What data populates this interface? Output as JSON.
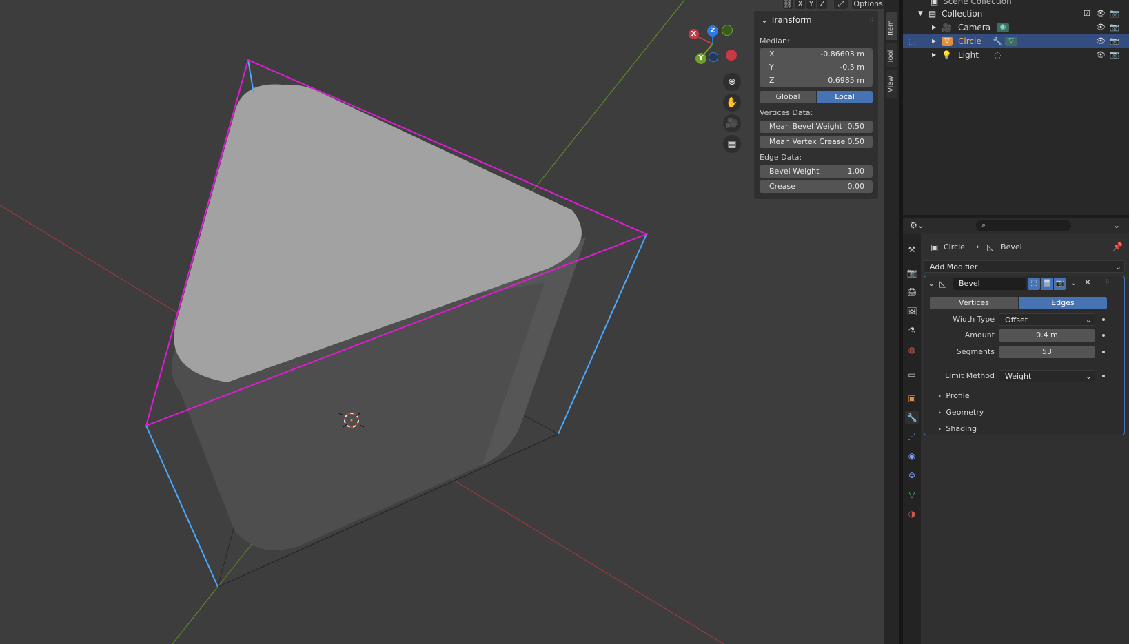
{
  "viewport": {
    "header_buttons": [
      "X",
      "Y",
      "Z"
    ],
    "options_label": "Options",
    "gizmo": {
      "x": "X",
      "y": "Y",
      "z": "Z"
    }
  },
  "npanel": {
    "title": "Transform",
    "median_label": "Median:",
    "x": {
      "label": "X",
      "value": "-0.86603 m"
    },
    "y": {
      "label": "Y",
      "value": "-0.5 m"
    },
    "z": {
      "label": "Z",
      "value": "0.6985 m"
    },
    "space": {
      "global": "Global",
      "local": "Local",
      "active": "Local"
    },
    "vertices_label": "Vertices Data:",
    "mean_bevel_weight": {
      "label": "Mean Bevel Weight",
      "value": "0.50"
    },
    "mean_vertex_crease": {
      "label": "Mean Vertex Crease",
      "value": "0.50"
    },
    "edge_label": "Edge Data:",
    "bevel_weight": {
      "label": "Bevel Weight",
      "value": "1.00"
    },
    "crease": {
      "label": "Crease",
      "value": "0.00"
    }
  },
  "side_tabs": [
    "Item",
    "Tool",
    "View"
  ],
  "outliner": {
    "scene_collection": "Scene Collection",
    "collection": "Collection",
    "items": [
      "Camera",
      "Circle",
      "Light"
    ]
  },
  "properties": {
    "breadcrumb_object": "Circle",
    "breadcrumb_modifier": "Bevel",
    "add_modifier": "Add Modifier",
    "modifier_name": "Bevel",
    "affect": {
      "vertices": "Vertices",
      "edges": "Edges",
      "active": "Edges"
    },
    "width_type": {
      "label": "Width Type",
      "value": "Offset"
    },
    "amount": {
      "label": "Amount",
      "value": "0.4 m"
    },
    "segments": {
      "label": "Segments",
      "value": "53"
    },
    "limit_method": {
      "label": "Limit Method",
      "value": "Weight"
    },
    "subpanels": [
      "Profile",
      "Geometry",
      "Shading"
    ]
  },
  "colors": {
    "selected_edge": "#e11bd6",
    "active_edge": "#4aa8ff",
    "x_axis": "#b8353f",
    "y_axis": "#6a9a2a",
    "accent": "#4772b3",
    "selected_row": "#334d80"
  }
}
